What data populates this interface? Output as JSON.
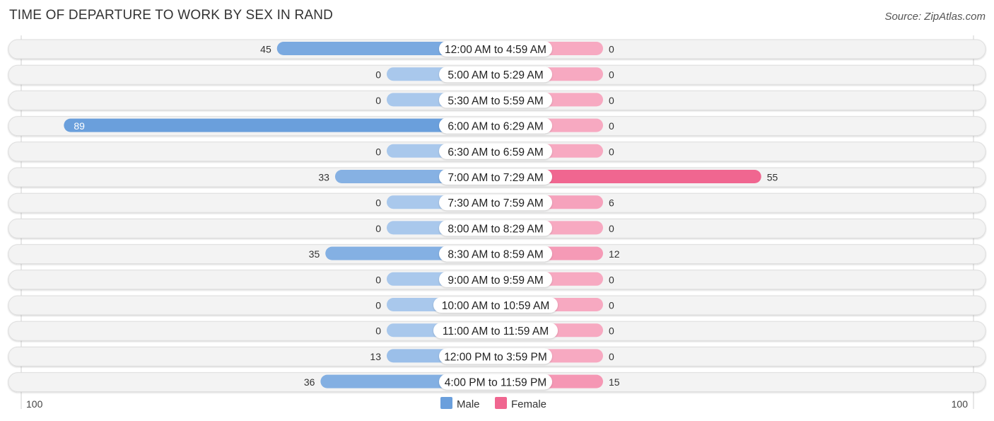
{
  "chart_data": {
    "type": "bar",
    "orientation": "diverging-horizontal",
    "title": "TIME OF DEPARTURE TO WORK BY SEX IN RAND",
    "source": "Source: ZipAtlas.com",
    "categories": [
      "12:00 AM to 4:59 AM",
      "5:00 AM to 5:29 AM",
      "5:30 AM to 5:59 AM",
      "6:00 AM to 6:29 AM",
      "6:30 AM to 6:59 AM",
      "7:00 AM to 7:29 AM",
      "7:30 AM to 7:59 AM",
      "8:00 AM to 8:29 AM",
      "8:30 AM to 8:59 AM",
      "9:00 AM to 9:59 AM",
      "10:00 AM to 10:59 AM",
      "11:00 AM to 11:59 AM",
      "12:00 PM to 3:59 PM",
      "4:00 PM to 11:59 PM"
    ],
    "series": [
      {
        "name": "Male",
        "color": "#6a9fdc",
        "values": [
          45,
          0,
          0,
          89,
          0,
          33,
          0,
          0,
          35,
          0,
          0,
          0,
          13,
          36
        ]
      },
      {
        "name": "Female",
        "color": "#f06690",
        "values": [
          0,
          0,
          0,
          0,
          0,
          55,
          6,
          0,
          12,
          0,
          0,
          0,
          0,
          15
        ]
      }
    ],
    "axis": {
      "left_label": "100",
      "right_label": "100",
      "range": [
        0,
        100
      ]
    },
    "legend": {
      "position": "bottom-center",
      "items": [
        "Male",
        "Female"
      ]
    }
  }
}
